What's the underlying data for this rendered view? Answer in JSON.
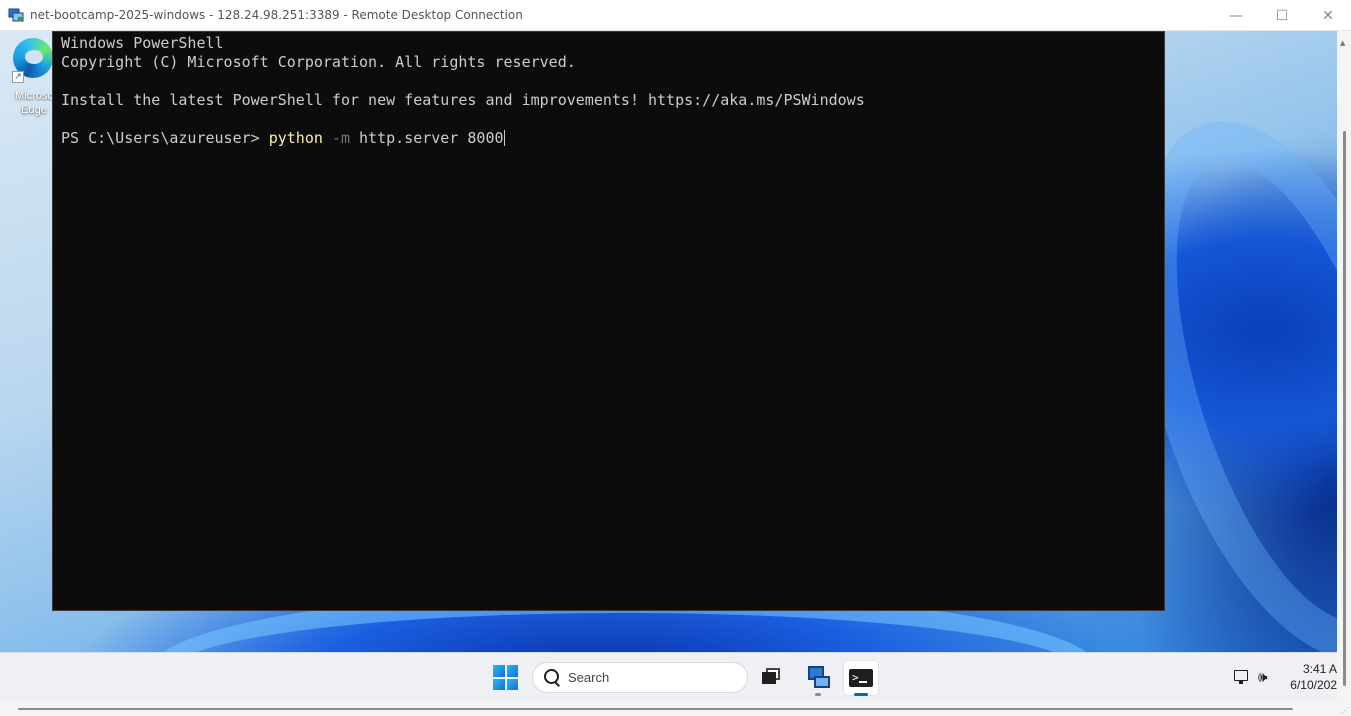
{
  "window": {
    "title": "net-bootcamp-2025-windows - 128.24.98.251:3389 - Remote Desktop Connection",
    "minimize_glyph": "—",
    "maximize_glyph": "☐",
    "close_glyph": "✕"
  },
  "desktop": {
    "icons": [
      {
        "label": "Microsoft Edge",
        "icon": "edge-icon"
      }
    ],
    "edge_label_visible": "Microsc Edge"
  },
  "terminal": {
    "lines": [
      "Windows PowerShell",
      "Copyright (C) Microsoft Corporation. All rights reserved.",
      "",
      "Install the latest PowerShell for new features and improvements! https://aka.ms/PSWindows",
      ""
    ],
    "prompt": "PS C:\\Users\\azureuser> ",
    "command": {
      "exe": "python",
      "flag": "-m",
      "args": "http.server 8000"
    },
    "colors": {
      "background": "#0c0c0c",
      "text": "#cccccc",
      "command": "#f9f1a5",
      "flag": "#767676"
    }
  },
  "taskbar": {
    "search_placeholder": "Search",
    "items": [
      {
        "name": "start",
        "icon": "windows-logo-icon"
      },
      {
        "name": "task-view",
        "icon": "task-view-icon"
      },
      {
        "name": "remote-desktop",
        "icon": "remote-desktop-icon"
      },
      {
        "name": "terminal",
        "icon": "terminal-icon",
        "active": true
      }
    ],
    "tray": {
      "network_icon": "network-icon",
      "volume_icon": "volume-icon",
      "volume_glyph": "🕪",
      "time": "3:41 A",
      "date": "6/10/202"
    }
  }
}
